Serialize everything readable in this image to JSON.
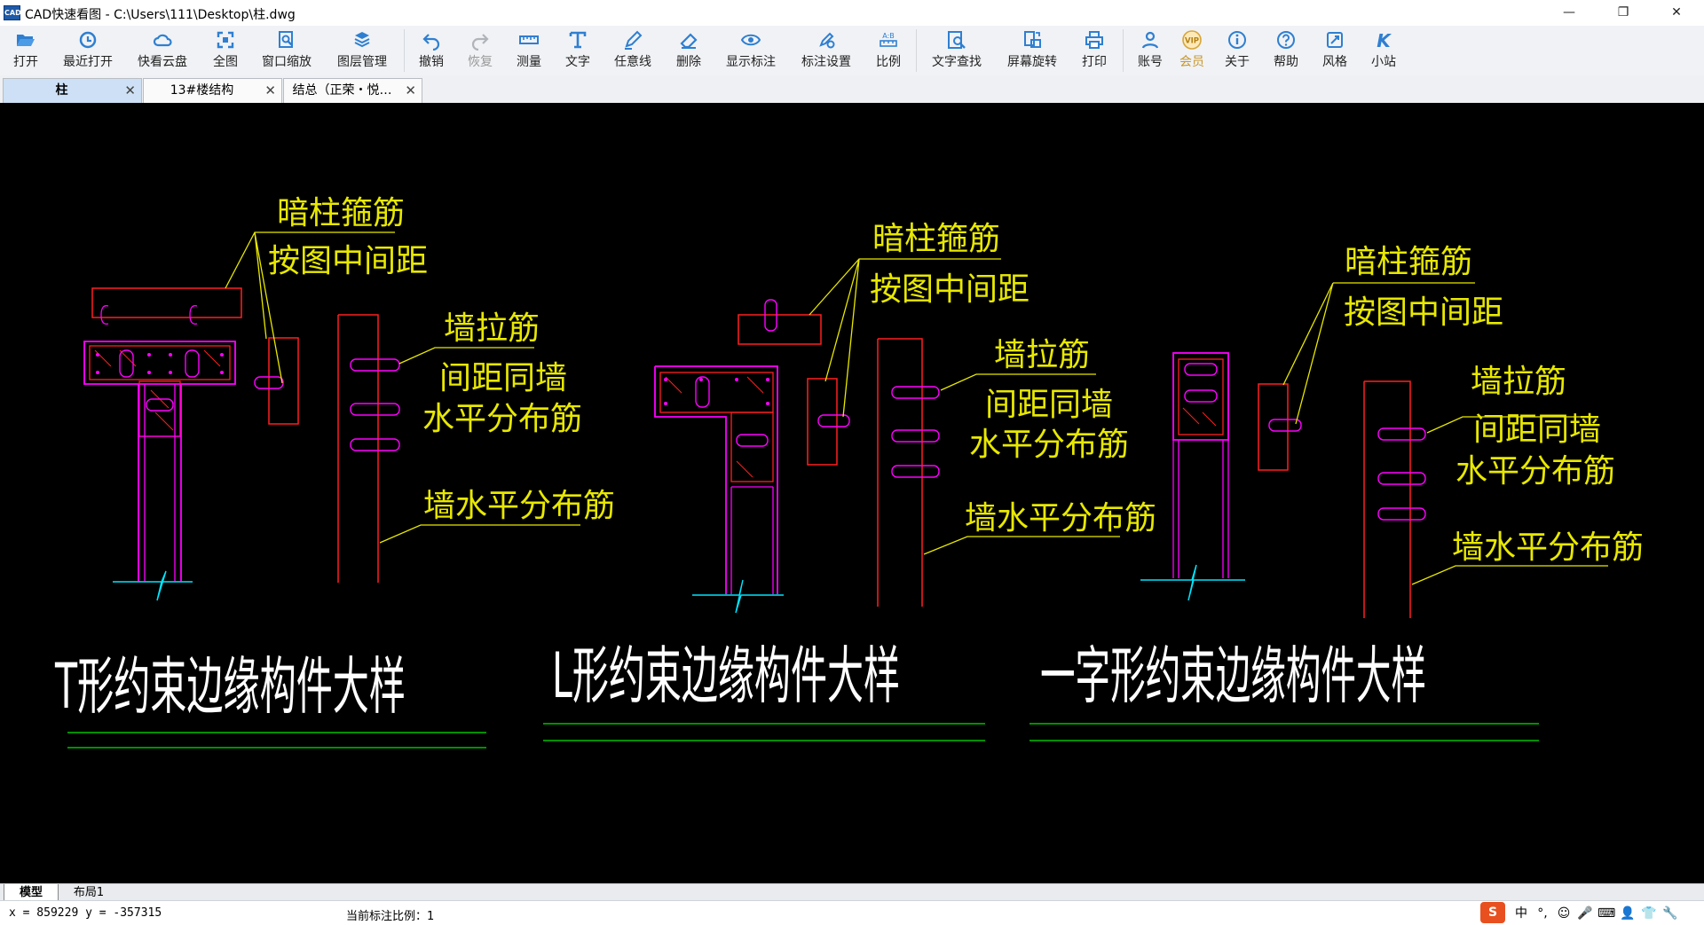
{
  "window": {
    "title": "CAD快速看图 - C:\\Users\\111\\Desktop\\柱.dwg",
    "icon_text": "CAD",
    "controls": {
      "minimize": "—",
      "restore": "❐",
      "close": "✕"
    }
  },
  "toolbar": {
    "items": [
      {
        "label": "打开",
        "icon": "folder-open-icon"
      },
      {
        "label": "最近打开",
        "icon": "clock-icon"
      },
      {
        "label": "快看云盘",
        "icon": "cloud-icon"
      },
      {
        "label": "全图",
        "icon": "fullscreen-icon"
      },
      {
        "label": "窗口缩放",
        "icon": "zoom-window-icon"
      },
      {
        "label": "图层管理",
        "icon": "layers-icon"
      },
      {
        "label": "撤销",
        "icon": "undo-icon"
      },
      {
        "label": "恢复",
        "icon": "redo-icon"
      },
      {
        "label": "测量",
        "icon": "ruler-icon"
      },
      {
        "label": "文字",
        "icon": "text-t-icon"
      },
      {
        "label": "任意线",
        "icon": "pencil-icon"
      },
      {
        "label": "删除",
        "icon": "eraser-icon"
      },
      {
        "label": "显示标注",
        "icon": "eye-icon"
      },
      {
        "label": "标注设置",
        "icon": "settings-pen-icon"
      },
      {
        "label": "比例",
        "icon": "scale-icon"
      },
      {
        "label": "文字查找",
        "icon": "find-text-icon"
      },
      {
        "label": "屏幕旋转",
        "icon": "rotate-screen-icon"
      },
      {
        "label": "打印",
        "icon": "printer-icon"
      },
      {
        "label": "账号",
        "icon": "user-icon"
      },
      {
        "label": "会员",
        "icon": "vip-badge-icon"
      },
      {
        "label": "关于",
        "icon": "info-icon"
      },
      {
        "label": "帮助",
        "icon": "help-icon"
      },
      {
        "label": "风格",
        "icon": "style-icon"
      },
      {
        "label": "小站",
        "icon": "k-logo-icon"
      }
    ],
    "vip_badge_text": "VIP",
    "k_logo_text": "K"
  },
  "tabs": [
    {
      "label": "柱",
      "active": true,
      "close": "✕"
    },
    {
      "label": "13#楼结构",
      "active": false,
      "close": "✕"
    },
    {
      "label": "结总（正荣・悦…",
      "active": false,
      "close": "✕"
    }
  ],
  "drawing": {
    "details": [
      {
        "title": "T形约束边缘构件大样",
        "hidden_label_1": "暗柱箍筋",
        "hidden_label_2": "按图中间距",
        "wall_tie_1": "墙拉筋",
        "wall_tie_2": "间距同墙",
        "wall_tie_3": "水平分布筋",
        "wall_horizontal": "墙水平分布筋"
      },
      {
        "title": "L形约束边缘构件大样",
        "hidden_label_1": "暗柱箍筋",
        "hidden_label_2": "按图中间距",
        "wall_tie_1": "墙拉筋",
        "wall_tie_2": "间距同墙",
        "wall_tie_3": "水平分布筋",
        "wall_horizontal": "墙水平分布筋"
      },
      {
        "title": "一字形约束边缘构件大样",
        "hidden_label_1": "暗柱箍筋",
        "hidden_label_2": "按图中间距",
        "wall_tie_1": "墙拉筋",
        "wall_tie_2": "间距同墙",
        "wall_tie_3": "水平分布筋",
        "wall_horizontal": "墙水平分布筋"
      }
    ],
    "colors": {
      "background": "#000000",
      "label_text": "#e8e800",
      "leader": "#e8e800",
      "rebar": "#ff00ff",
      "concrete_outline": "#ff1f1f",
      "break_line": "#00e5ff",
      "underline": "#00c000",
      "title_text": "#ffffff"
    }
  },
  "layout_tabs": [
    {
      "label": "模型",
      "active": true
    },
    {
      "label": "布局1",
      "active": false
    }
  ],
  "status": {
    "coords": "x = 859229  y = -357315",
    "scale_label": "当前标注比例：1"
  },
  "tray": {
    "ime_logo": "S",
    "items": [
      "中",
      "°,",
      "☺",
      "🎤",
      "⌨",
      "👤",
      "👕",
      "🔧"
    ]
  }
}
